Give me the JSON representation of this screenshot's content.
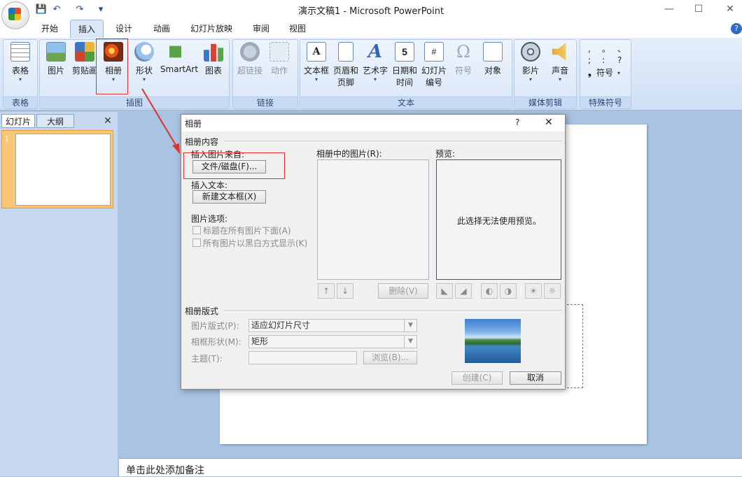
{
  "window": {
    "title": "演示文稿1 - Microsoft PowerPoint",
    "minimize": "—",
    "maximize": "☐",
    "close": "✕"
  },
  "qat": {
    "save": "💾",
    "undo": "↶",
    "redo": "↷",
    "more": "▾"
  },
  "tabs": [
    "开始",
    "插入",
    "设计",
    "动画",
    "幻灯片放映",
    "审阅",
    "视图"
  ],
  "active_tab": "插入",
  "ribbon": {
    "groups": [
      "表格",
      "插图",
      "链接",
      "文本",
      "媒体剪辑",
      "特殊符号"
    ],
    "buttons": {
      "table": "表格",
      "picture": "图片",
      "clipart": "剪贴画",
      "album": "相册",
      "shapes": "形状",
      "smartart": "SmartArt",
      "chart": "图表",
      "hyperlink": "超链接",
      "action": "动作",
      "textbox": "文本框",
      "header_footer_1": "页眉和",
      "header_footer_2": "页脚",
      "wordart": "艺术字",
      "datetime_1": "日期和",
      "datetime_2": "时间",
      "slidenum_1": "幻灯片",
      "slidenum_2": "编号",
      "symbol": "符号",
      "object": "对象",
      "movie": "影片",
      "sound": "声音",
      "special_symbol": "符号"
    },
    "special_chars": [
      ",",
      "。",
      "、",
      ";",
      ":",
      "?",
      "❟"
    ]
  },
  "left_pane": {
    "tab_slides": "幻灯片",
    "tab_outline": "大纲",
    "slide_number": "1"
  },
  "notes": {
    "placeholder": "单击此处添加备注"
  },
  "dialog": {
    "title": "相册",
    "help": "?",
    "close": "✕",
    "section_content": "相册内容",
    "insert_picture_from": "插入图片来自:",
    "file_disk_button": "文件/磁盘(F)...",
    "insert_text": "插入文本:",
    "new_textbox_button": "新建文本框(X)",
    "picture_options": "图片选项:",
    "option_captions": "标题在所有图片下面(A)",
    "option_bw": "所有图片以黑白方式显示(K)",
    "pictures_in_album": "相册中的图片(R):",
    "preview_label": "预览:",
    "preview_message": "此选择无法使用预览。",
    "move_up": "↑",
    "move_down": "↓",
    "delete_button": "删除(V)",
    "section_layout": "相册版式",
    "picture_layout_label": "图片版式(P):",
    "picture_layout_value": "适应幻灯片尺寸",
    "frame_shape_label": "相框形状(M):",
    "frame_shape_value": "矩形",
    "theme_label": "主题(T):",
    "theme_value": "",
    "browse_button": "浏览(B)...",
    "create_button": "创建(C)",
    "cancel_button": "取消"
  }
}
